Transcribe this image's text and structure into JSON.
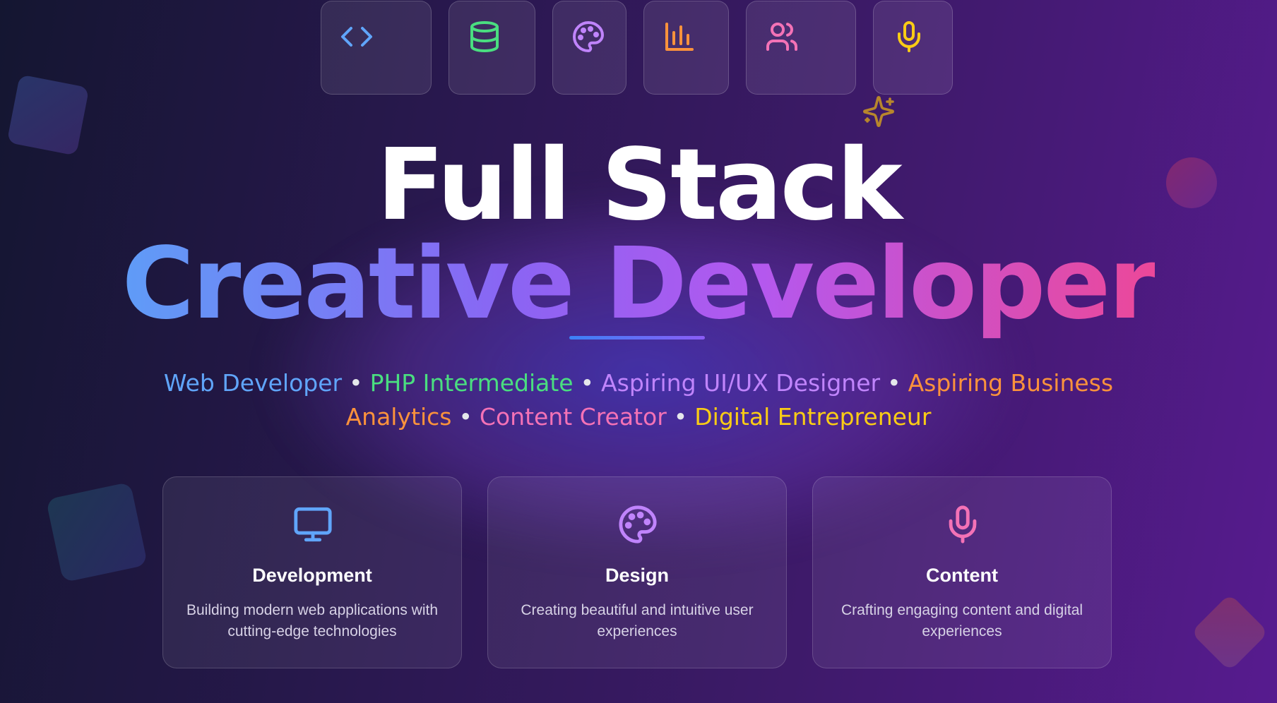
{
  "tools": [
    {
      "icon": "code-icon",
      "color": "#60a5fa"
    },
    {
      "icon": "database-icon",
      "color": "#4ade80"
    },
    {
      "icon": "palette-icon",
      "color": "#c084fc"
    },
    {
      "icon": "bar-chart-icon",
      "color": "#fb923c"
    },
    {
      "icon": "users-icon",
      "color": "#f472b6"
    },
    {
      "icon": "microphone-icon",
      "color": "#facc15"
    }
  ],
  "hero": {
    "title": "Full Stack",
    "subtitle": "Creative Developer"
  },
  "roles": [
    {
      "label": "Web Developer",
      "color": "#60a5fa"
    },
    {
      "label": "PHP Intermediate",
      "color": "#4ade80"
    },
    {
      "label": "Aspiring UI/UX Designer",
      "color": "#c084fc"
    },
    {
      "label": "Aspiring Business Analytics",
      "color": "#fb923c"
    },
    {
      "label": "Content Creator",
      "color": "#f472b6"
    },
    {
      "label": "Digital Entrepreneur",
      "color": "#facc15"
    }
  ],
  "separator": "•",
  "cards": [
    {
      "icon": "monitor-icon",
      "color": "#60a5fa",
      "title": "Development",
      "description": "Building modern web applications with cutting-edge technologies"
    },
    {
      "icon": "palette-icon",
      "color": "#c084fc",
      "title": "Design",
      "description": "Creating beautiful and intuitive user experiences"
    },
    {
      "icon": "microphone-icon",
      "color": "#f472b6",
      "title": "Content",
      "description": "Crafting engaging content and digital experiences"
    }
  ]
}
